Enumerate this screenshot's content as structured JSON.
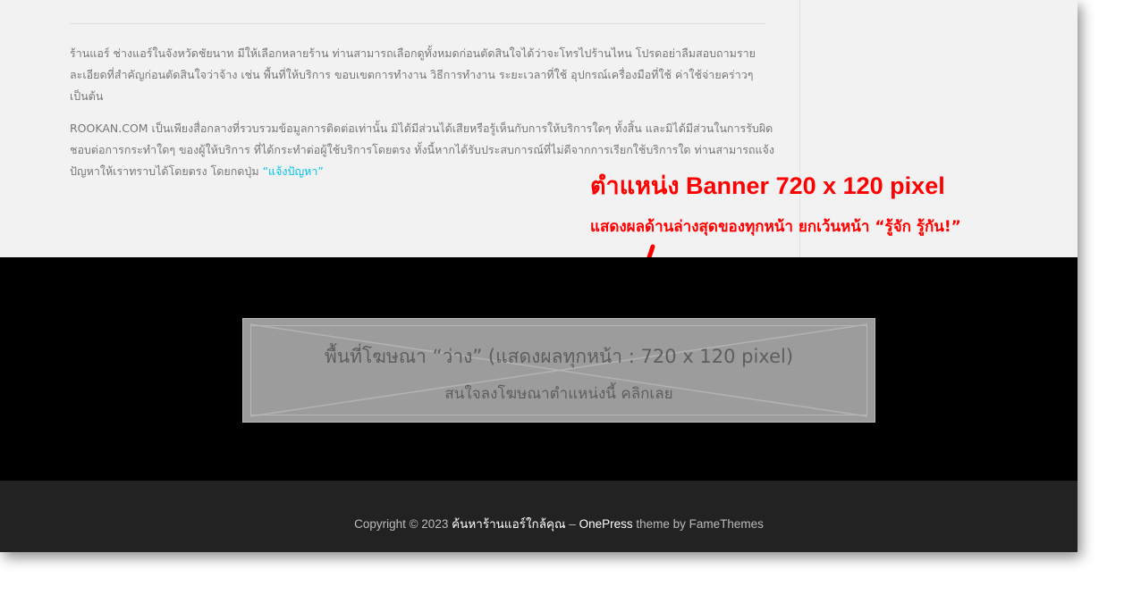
{
  "content": {
    "paragraph1": "ร้านแอร์ ช่างแอร์ในจังหวัดชัยนาท มีให้เลือกหลายร้าน ท่านสามารถเลือกดูทั้งหมดก่อนตัดสินใจได้ว่าจะโทรไปร้านไหน โปรดอย่าลืมสอบถามรายละเอียดที่สำคัญก่อนตัดสินใจว่าจ้าง เช่น พื้นที่ให้บริการ ขอบเขตการทำงาน วิธีการทำงาน ระยะเวลาที่ใช้ อุปกรณ์เครื่องมือที่ใช้ ค่าใช้จ่ายคร่าวๆ เป็นต้น",
    "paragraph2": "ROOKAN.COM เป็นเพียงสื่อกลางที่รวบรวมข้อมูลการติดต่อเท่านั้น มิได้มีส่วนได้เสียหรือรู้เห็นกับการให้บริการใดๆ ทั้งสิ้น และมิได้มีส่วนในการรับผิดชอบต่อการกระทำใดๆ ของผู้ให้บริการ ที่ได้กระทำต่อผู้ใช้บริการโดยตรง ทั้งนี้หากได้รับประสบการณ์ที่ไม่ดีจากการเรียกใช้บริการใด ท่านสามารถแจ้งปัญหาให้เราทราบได้โดยตรง โดยกดปุ่ม",
    "report_link": "“แจ้งปัญหา”"
  },
  "annotation": {
    "title": "ตำแหน่ง Banner 720 x 120 pixel",
    "subtitle": "แสดงผลด้านล่างสุดของทุกหน้า ยกเว้นหน้า “รู้จัก รู้กัน!”",
    "color": "#ff0000"
  },
  "ad": {
    "line1": "พื้นที่โฆษณา “ว่าง” (แสดงผลทุกหน้า : 720 x 120 pixel)",
    "line2": "สนใจลงโฆษณาตำแหน่งนี้ คลิกเลย"
  },
  "footer": {
    "copyright_prefix": "Copyright © 2023",
    "site_name": "ค้นหาร้านแอร์ใกล้คุณ",
    "separator": " – ",
    "theme_name": "OnePress",
    "theme_by": " theme by ",
    "theme_author": "FameThemes"
  },
  "colors": {
    "content_bg": "#f2f2f2",
    "footer_widgets_bg": "#000000",
    "footer_bg": "#222222",
    "link_accent": "#03c4eb"
  }
}
